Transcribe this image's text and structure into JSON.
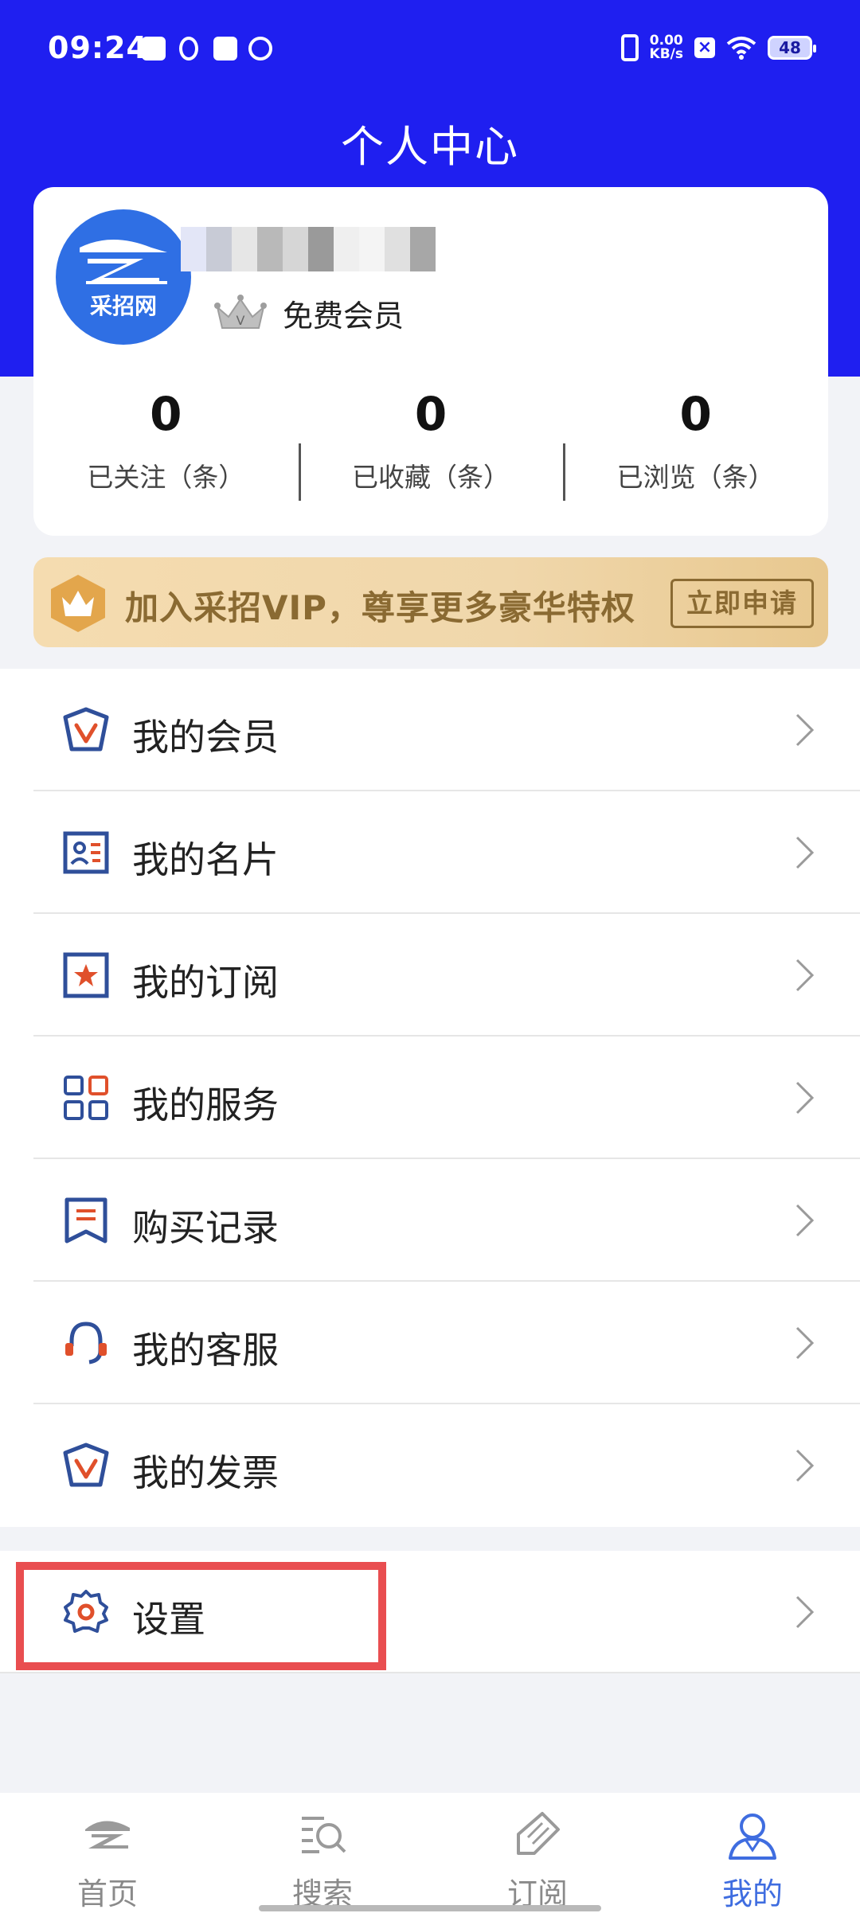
{
  "status_bar": {
    "time": "09:24",
    "net_speed_value": "0.00",
    "net_speed_unit": "KB/s",
    "battery": "48"
  },
  "header": {
    "title": "个人中心"
  },
  "profile": {
    "avatar_text": "采招网",
    "membership": "免费会员",
    "stats": [
      {
        "value": "0",
        "label": "已关注（条）"
      },
      {
        "value": "0",
        "label": "已收藏（条）"
      },
      {
        "value": "0",
        "label": "已浏览（条）"
      }
    ]
  },
  "vip_banner": {
    "text": "加入采招VIP，尊享更多豪华特权",
    "button": "立即申请"
  },
  "menu": [
    {
      "label": "我的会员",
      "icon": "vip-shield-icon"
    },
    {
      "label": "我的名片",
      "icon": "business-card-icon"
    },
    {
      "label": "我的订阅",
      "icon": "star-box-icon"
    },
    {
      "label": "我的服务",
      "icon": "grid-icon"
    },
    {
      "label": "购买记录",
      "icon": "bookmark-icon"
    },
    {
      "label": "我的客服",
      "icon": "headset-icon"
    },
    {
      "label": "我的发票",
      "icon": "invoice-shield-icon"
    }
  ],
  "settings": {
    "label": "设置",
    "icon": "gear-icon"
  },
  "bottom_nav": [
    {
      "label": "首页",
      "icon": "home-logo-icon",
      "active": false
    },
    {
      "label": "搜索",
      "icon": "search-list-icon",
      "active": false
    },
    {
      "label": "订阅",
      "icon": "pencil-diamond-icon",
      "active": false
    },
    {
      "label": "我的",
      "icon": "person-icon",
      "active": true
    }
  ],
  "colors": {
    "primary_blue": "#1f1ff0",
    "accent_blue": "#3f6de0",
    "icon_red": "#e0502b",
    "vip_gold": "#8a6a32",
    "highlight_red": "#e94e50"
  }
}
